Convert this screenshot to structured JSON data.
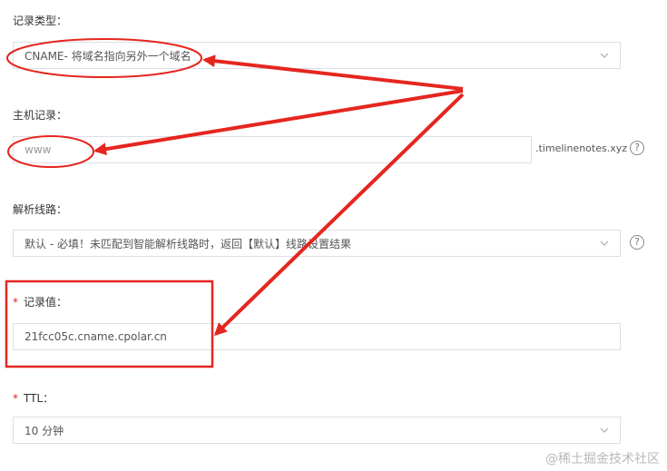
{
  "record_type": {
    "label": "记录类型：",
    "value": "CNAME- 将域名指向另外一个域名"
  },
  "host_record": {
    "label": "主机记录：",
    "placeholder": "www",
    "suffix": ".timelinenotes.xyz"
  },
  "line": {
    "label": "解析线路：",
    "value": "默认 - 必填！未匹配到智能解析线路时，返回【默认】线路设置结果"
  },
  "record_value": {
    "required_mark": "*",
    "label": "记录值：",
    "value": "21fcc05c.cname.cpolar.cn"
  },
  "ttl": {
    "required_mark": "*",
    "label": "TTL：",
    "value": "10 分钟"
  },
  "help_glyph": "?",
  "watermark": "@稀土掘金技术社区",
  "colors": {
    "annotation": "#e5261f",
    "border": "#dcdfe6",
    "required": "#e02020"
  }
}
